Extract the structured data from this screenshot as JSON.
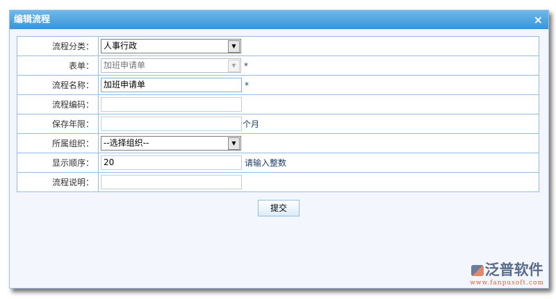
{
  "dialog": {
    "title": "编辑流程",
    "close": "×"
  },
  "form": {
    "category": {
      "label": "流程分类：",
      "value": "人事行政"
    },
    "form": {
      "label": "表单：",
      "value": "加班申请单",
      "required": "*"
    },
    "name": {
      "label": "流程名称：",
      "value": "加班申请单",
      "required": "*"
    },
    "code": {
      "label": "流程编码：",
      "value": ""
    },
    "retention": {
      "label": "保存年限：",
      "value": "",
      "unit": "个月"
    },
    "org": {
      "label": "所属组织：",
      "value": "--选择组织--"
    },
    "order": {
      "label": "显示顺序：",
      "value": "20",
      "hint": "请输入整数"
    },
    "desc": {
      "label": "流程说明：",
      "value": ""
    }
  },
  "submit": "提交",
  "watermark": {
    "name": "泛普软件",
    "url": "www.fanpusoft.com"
  }
}
